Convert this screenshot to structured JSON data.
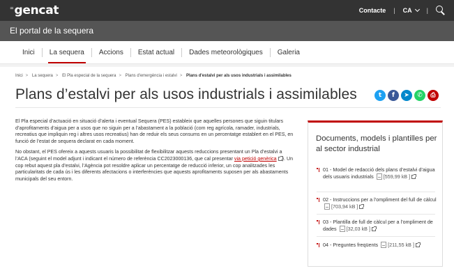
{
  "header": {
    "logo_mark": "⁼",
    "logo": "gencat",
    "contact": "Contacte",
    "language": "CA",
    "search_icon": "search-icon"
  },
  "portal": {
    "title": "El portal de la sequera"
  },
  "nav": {
    "items": [
      "Inici",
      "La sequera",
      "Accions",
      "Estat actual",
      "Dades meteorològiques",
      "Galeria"
    ],
    "active": "La sequera"
  },
  "breadcrumb": [
    "Inici",
    "La sequera",
    "El Pla especial de la sequera",
    "Plans d'emergència i estalvi",
    "Plans d'estalvi per als usos industrials i assimilables"
  ],
  "page": {
    "title": "Plans d’estalvi per als usos industrials i assimilables",
    "share": [
      "twitter-icon",
      "facebook-icon",
      "telegram-icon",
      "whatsapp-icon",
      "print-icon"
    ],
    "share_colors": [
      "#1da1f2",
      "#3b5998",
      "#0088cc",
      "#25d366",
      "#c00000"
    ],
    "paragraph1": "El Pla especial d’actuació en situació d’alerta i eventual Sequera (PES) estableix que aquelles persones que siguin titulars d’aprofitaments d’aigua per a usos que no siguin per a l’abastament a la població (com reg agrícola, ramader, industrials, recreatius que impliquin reg i altres usos recreatius) han de reduir els seus consums en un percentatge establert en el PES, en funció de l’estat de sequera declarat en cada moment.",
    "paragraph2_a": "No obstant, el PES ofereix a aquests usuaris la possibilitat de flexibilitzar aquests reduccions presentant un Pla d’estalvi a l’ACA (seguint el model adjunt i indicant el número de referència CC2023000136, que cal presentar ",
    "paragraph2_link": "via petició genèrica",
    "paragraph2_b": "). Un cop rebut aquest pla d’estalvi, l’Agència pot resoldre aplicar un percentatge de reducció inferior, un cop analitzades les particularitats de cada ús i les diferents afectacions o interferències que aquests aprofitaments suposen per als abastaments municipals del seu entorn."
  },
  "sidebar": {
    "title": "Documents, models i plantilles per al sector industrial",
    "docs": [
      {
        "title": "01 - Model de redacció dels plans d’estalvi d’aigua dels usuaris industrials",
        "size": "[559,99 kB ]"
      },
      {
        "title": "02 - Instruccions per a l’ompliment del full de càlcul",
        "size": "[703,94 kB ]"
      },
      {
        "title": "03 - Plantilla de full de càlcul per a l’ompliment de dades",
        "size": "[32,03 kB ]"
      },
      {
        "title": "04 - Preguntes freqüents",
        "size": "[211,55 kB ]"
      }
    ]
  },
  "colors": {
    "accent": "#c00000",
    "topbar": "#333333",
    "portalbar": "#555555"
  }
}
